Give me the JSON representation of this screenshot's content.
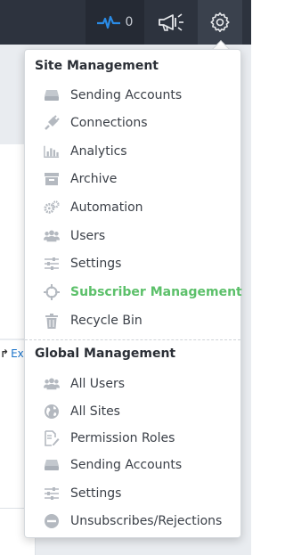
{
  "header": {
    "activity_count": "0"
  },
  "background": {
    "link_text": "Ex"
  },
  "site_management": {
    "title": "Site Management",
    "items": [
      {
        "label": "Sending Accounts",
        "icon": "hdd-icon"
      },
      {
        "label": "Connections",
        "icon": "plug-icon"
      },
      {
        "label": "Analytics",
        "icon": "bar-chart-icon"
      },
      {
        "label": "Archive",
        "icon": "archive-icon"
      },
      {
        "label": "Automation",
        "icon": "cogs-icon"
      },
      {
        "label": "Users",
        "icon": "users-icon"
      },
      {
        "label": "Settings",
        "icon": "sliders-icon"
      },
      {
        "label": "Subscriber Management",
        "icon": "crosshair-icon",
        "active": true
      },
      {
        "label": "Recycle Bin",
        "icon": "trash-icon"
      }
    ]
  },
  "global_management": {
    "title": "Global Management",
    "items": [
      {
        "label": "All Users",
        "icon": "users-icon"
      },
      {
        "label": "All Sites",
        "icon": "globe-icon"
      },
      {
        "label": "Permission Roles",
        "icon": "edit-document-icon"
      },
      {
        "label": "Sending Accounts",
        "icon": "hdd-icon"
      },
      {
        "label": "Settings",
        "icon": "sliders-icon"
      },
      {
        "label": "Unsubscribes/Rejections",
        "icon": "minus-circle-icon"
      }
    ]
  },
  "colors": {
    "topbar": "#2d333e",
    "accent_blue": "#2a8be6",
    "active_green": "#5cc06a",
    "icon_gray": "#b4b9c0"
  }
}
